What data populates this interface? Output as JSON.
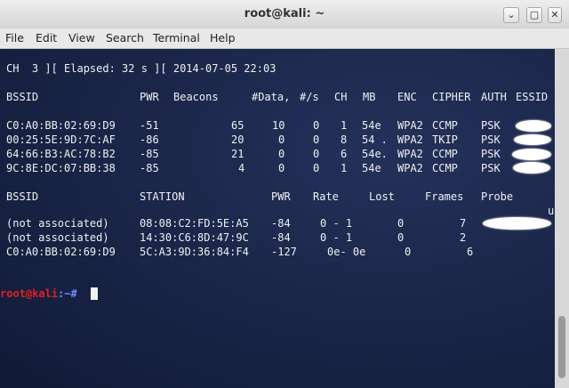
{
  "window": {
    "title": "root@kali: ~",
    "buttons": {
      "minimize": "⌄",
      "maximize": "▢",
      "close": "✕"
    }
  },
  "menu": [
    "File",
    "Edit",
    "View",
    "Search",
    "Terminal",
    "Help"
  ],
  "terminal": {
    "status_line": "CH  3 ][ Elapsed: 32 s ][ 2014-07-05 22:03",
    "ap_headers": [
      "BSSID",
      "PWR",
      "Beacons",
      "#Data,",
      "#/s",
      "CH",
      "MB",
      "ENC",
      "CIPHER",
      "AUTH",
      "ESSID"
    ],
    "ap_rows": [
      [
        "C0:A0:BB:02:69:D9",
        "-51",
        "65",
        "10",
        "0",
        "1",
        "54e",
        "WPA2",
        "CCMP",
        "PSK"
      ],
      [
        "00:25:5E:9D:7C:AF",
        "-86",
        "20",
        "0",
        "0",
        "8",
        "54 .",
        "WPA2",
        "TKIP",
        "PSK"
      ],
      [
        "64:66:B3:AC:78:B2",
        "-85",
        "21",
        "0",
        "0",
        "6",
        "54e.",
        "WPA2",
        "CCMP",
        "PSK"
      ],
      [
        "9C:8E:DC:07:BB:38",
        "-85",
        "4",
        "0",
        "0",
        "1",
        "54e",
        "WPA2",
        "CCMP",
        "PSK"
      ]
    ],
    "sta_headers": [
      "BSSID",
      "STATION",
      "PWR",
      "Rate",
      "Lost",
      "Frames",
      "Probe"
    ],
    "sta_stray": "u",
    "sta_rows": [
      [
        "(not associated)",
        "08:08:C2:FD:5E:A5",
        "-84",
        "0 - 1",
        "0",
        "7"
      ],
      [
        "(not associated)",
        "14:30:C6:8D:47:9C",
        "-84",
        "0 - 1",
        "0",
        "2"
      ],
      [
        "C0:A0:BB:02:69:D9",
        "5C:A3:9D:36:84:F4",
        "-127",
        "0e- 0e",
        "0",
        "6"
      ]
    ],
    "prompt": {
      "user": "root@kali",
      "path": ":~#"
    }
  }
}
